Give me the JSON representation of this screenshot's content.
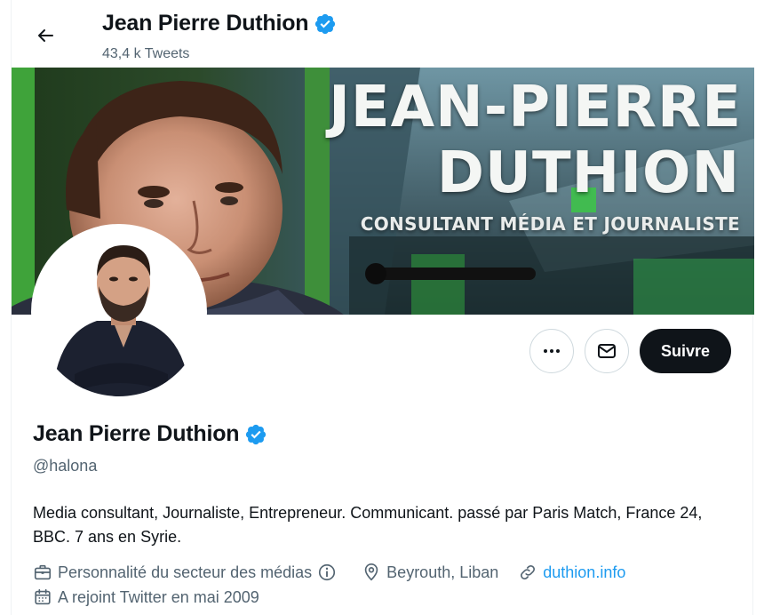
{
  "header": {
    "back_icon": "arrow-left-icon",
    "name": "Jean Pierre Duthion",
    "tweet_count": "43,4 k Tweets",
    "verified_icon": "verified-badge-icon"
  },
  "banner": {
    "line1": "JEAN-PIERRE",
    "line2": "DUTHION",
    "line3": "CONSULTANT MÉDIA ET JOURNALISTE"
  },
  "actions": {
    "more_icon": "more-dots-icon",
    "message_icon": "envelope-icon",
    "follow_label": "Suivre"
  },
  "profile": {
    "name": "Jean Pierre Duthion",
    "handle": "@halona",
    "bio": "Media consultant, Journaliste, Entrepreneur. Communicant. passé par Paris Match, France 24, BBC. 7 ans en Syrie.",
    "category": "Personnalité du secteur des médias",
    "location": "Beyrouth, Liban",
    "website": "duthion.info",
    "joined": "A rejoint Twitter en mai 2009"
  },
  "colors": {
    "accent": "#1d9bf0",
    "text": "#0f1419",
    "muted": "#536471",
    "follow_bg": "#0f1419"
  }
}
